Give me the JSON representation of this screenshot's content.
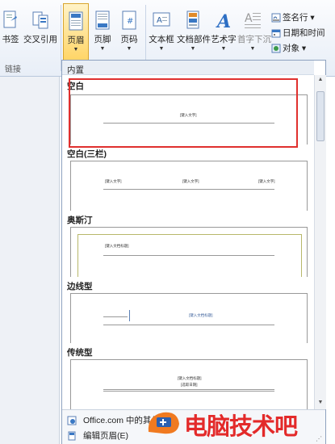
{
  "ribbon": {
    "buttons": [
      {
        "label": "书签",
        "icon": "bookmark-icon"
      },
      {
        "label": "交叉引用",
        "icon": "cross-reference-icon"
      },
      {
        "label": "页眉",
        "icon": "header-icon"
      },
      {
        "label": "页脚",
        "icon": "footer-icon"
      },
      {
        "label": "页码",
        "icon": "page-number-icon"
      },
      {
        "label": "文本框",
        "icon": "text-box-icon"
      },
      {
        "label": "文档部件",
        "icon": "quick-parts-icon"
      },
      {
        "label": "艺术字",
        "icon": "wordart-icon"
      },
      {
        "label": "首字下沉",
        "icon": "drop-cap-icon"
      }
    ],
    "small": [
      {
        "label": "签名行 ▾",
        "icon": "signature-line-icon"
      },
      {
        "label": "日期和时间",
        "icon": "date-time-icon"
      },
      {
        "label": "对象 ▾",
        "icon": "object-icon"
      }
    ],
    "group_label": "链接"
  },
  "gallery": {
    "header": "内置",
    "categories": [
      {
        "name": "空白",
        "texts": [
          "[键入文字]"
        ]
      },
      {
        "name": "空白(三栏)",
        "texts": [
          "[键入文字]",
          "[键入文字]",
          "[键入文字]"
        ]
      },
      {
        "name": "奥斯汀",
        "texts": [
          "[键入文档标题]"
        ]
      },
      {
        "name": "边线型",
        "texts": [
          "[键入文档标题]"
        ]
      },
      {
        "name": "传统型",
        "texts": [
          "[键入文档标题]",
          "[选取日期]"
        ]
      }
    ],
    "footer": [
      {
        "label": "Office.com 中的其他页眉",
        "icon": "office-com-icon"
      },
      {
        "label": "编辑页眉(E)",
        "icon": "edit-header-icon"
      }
    ]
  },
  "watermark": {
    "text": "电脑技术吧"
  },
  "colors": {
    "accent_red": "#e0302e",
    "active_button": "#ffd567"
  }
}
